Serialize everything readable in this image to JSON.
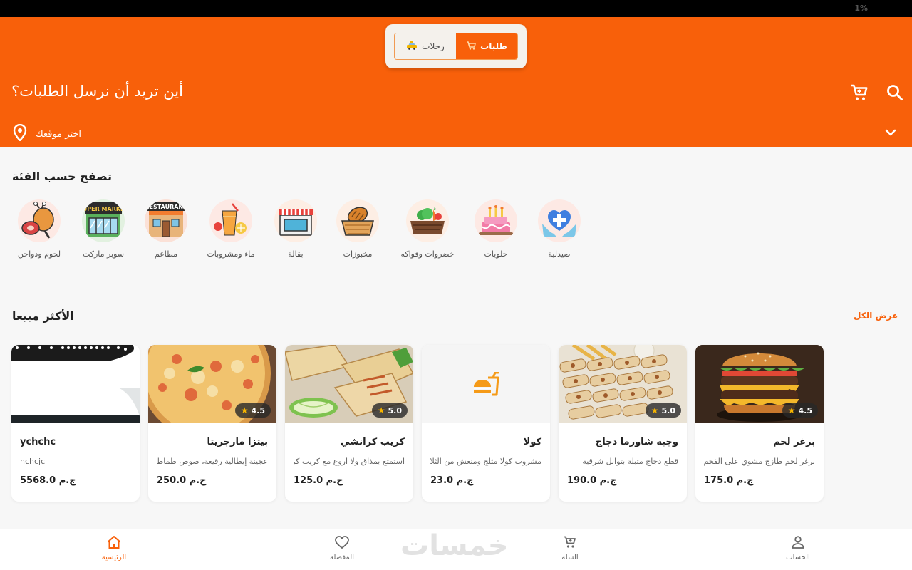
{
  "status_bar": {
    "battery": "1%"
  },
  "header": {
    "tabs": {
      "orders": {
        "label": "طلبات",
        "icon": "cart-icon"
      },
      "rides": {
        "label": "رحلات",
        "icon": "taxi-icon"
      }
    },
    "title": "أين تريد أن نرسل الطلبات؟",
    "location_label": "اختر موقعك"
  },
  "categories_section": {
    "title": "تصفح حسب الفئة",
    "items": [
      {
        "label": "صيدلية",
        "icon": "pharmacy-icon"
      },
      {
        "label": "حلويات",
        "icon": "cake-icon"
      },
      {
        "label": "خضروات وفواكه",
        "icon": "vegetables-icon"
      },
      {
        "label": "مخبوزات",
        "icon": "bread-basket-icon"
      },
      {
        "label": "بقالة",
        "icon": "grocery-store-icon"
      },
      {
        "label": "ماء ومشروبات",
        "icon": "juice-icon"
      },
      {
        "label": "مطاعم",
        "icon": "restaurant-icon"
      },
      {
        "label": "سوبر ماركت",
        "icon": "supermarket-icon"
      },
      {
        "label": "لحوم ودواجن",
        "icon": "meat-poultry-icon"
      }
    ],
    "supermarket_sign_text": "SUPER MARKET",
    "restaurant_sign_text": "RESTAURANT"
  },
  "bestsellers": {
    "title": "الأكثر مبيعا",
    "view_all": "عرض الكل",
    "products": [
      {
        "name": "برغر لحم",
        "description": "برغر لحم طازج مشوي على الفحم",
        "price": "ج.م 175.0",
        "rating": "4.5"
      },
      {
        "name": "وجبه شاورما دجاج",
        "description": "قطع دجاج متبلة بتوابل شرقية",
        "price": "ج.م 190.0",
        "rating": "5.0"
      },
      {
        "name": "كولا",
        "description": "مشروب كولا مثلج ومنعش من الثلاجة",
        "price": "ج.م 23.0"
      },
      {
        "name": "كريب كرانشي",
        "description": "استمتع بمذاق ولا أروع مع كريب كرانشي",
        "price": "ج.م 125.0",
        "rating": "5.0"
      },
      {
        "name": "بيتزا مارجريتا",
        "description": "عجينة إيطالية رقيعة، صوص طماطم",
        "price": "ج.م 250.0",
        "rating": "4.5"
      },
      {
        "name": "ychchc",
        "description": "hchcjc",
        "price": "ج.م 5568.0"
      }
    ]
  },
  "bottom_nav": {
    "account": "الحساب",
    "cart": "السلة",
    "favorites": "المفضلة",
    "home": "الرئيسية"
  },
  "watermark": "خمسات",
  "colors": {
    "accent": "#f8600a",
    "background": "#f7f7f7",
    "star": "#f7b500"
  }
}
